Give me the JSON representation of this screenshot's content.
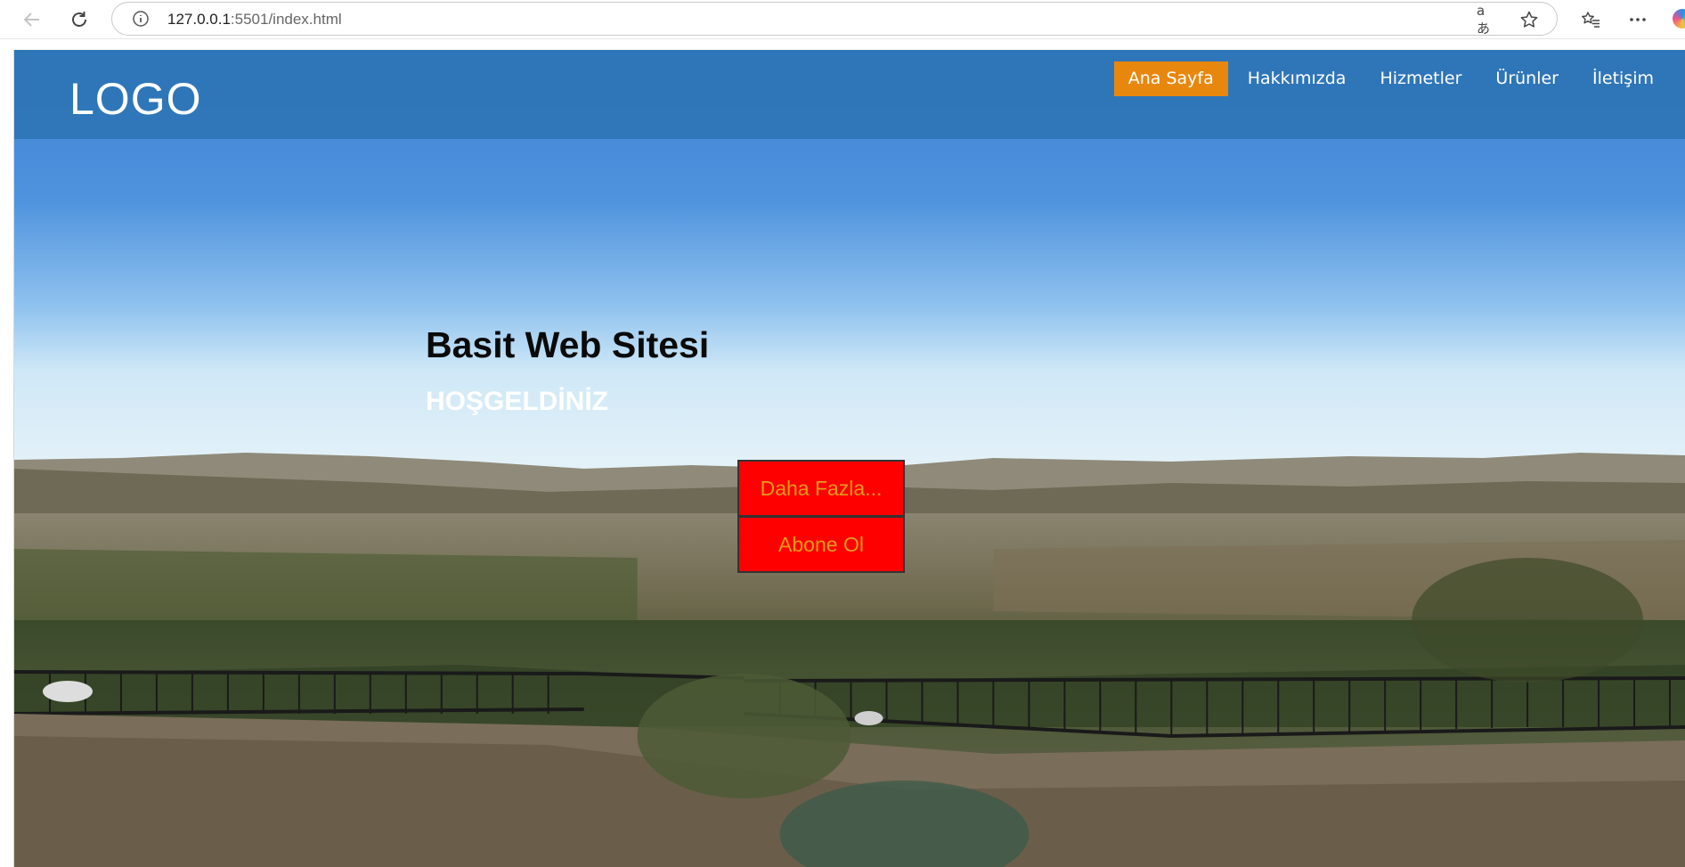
{
  "browser": {
    "url_host": "127.0.0.1",
    "url_rest": ":5501/index.html",
    "icons": [
      "back-arrow-icon",
      "reload-icon",
      "info-icon",
      "translate-icon",
      "star-icon",
      "favorites-icon",
      "more-icon",
      "copilot-icon"
    ],
    "translate_glyph": "aあ"
  },
  "site": {
    "logo": "LOGO",
    "nav": [
      {
        "label": "Ana Sayfa",
        "active": true
      },
      {
        "label": "Hakkımızda",
        "active": false
      },
      {
        "label": "Hizmetler",
        "active": false
      },
      {
        "label": "Ürünler",
        "active": false
      },
      {
        "label": "İletişim",
        "active": false
      }
    ],
    "colors": {
      "header": "#2e75b6",
      "nav_active": "#e8870e",
      "cta_bg": "#ff0000",
      "cta_text": "#e89a1a"
    }
  },
  "hero": {
    "title": "Basit Web Sitesi",
    "subtitle": "HOŞGELDİNİZ",
    "buttons": {
      "more": "Daha Fazla...",
      "subscribe": "Abone Ol"
    }
  }
}
